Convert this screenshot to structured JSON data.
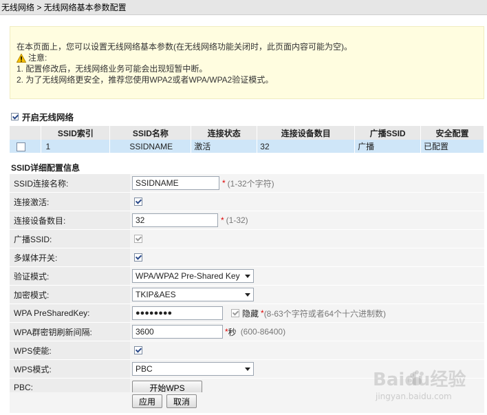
{
  "breadcrumb": "无线网络 > 无线网络基本参数配置",
  "notice": {
    "line1": "在本页面上，您可以设置无线网络基本参数(在无线网络功能关闭时，此页面内容可能为空)。",
    "warning_label": "注意:",
    "line2": "1. 配置修改后，无线网络业务可能会出现短暂中断。",
    "line3": "2. 为了无线网络更安全，推荐您使用WPA2或者WPA/WPA2验证模式。"
  },
  "enable_wifi": {
    "label": "开启无线网络",
    "checked": true
  },
  "ssid_table": {
    "headers": [
      "",
      "SSID索引",
      "SSID名称",
      "连接状态",
      "连接设备数目",
      "广播SSID",
      "安全配置"
    ],
    "rows": [
      {
        "checked": false,
        "index": "1",
        "name": "SSIDNAME",
        "status": "激活",
        "devices": "32",
        "broadcast": "广播",
        "security": "已配置"
      }
    ]
  },
  "detail": {
    "section_title": "SSID详细配置信息",
    "ssid_name_label": "SSID连接名称:",
    "ssid_name_value": "SSIDNAME",
    "ssid_name_hint": "(1-32个字符)",
    "enable_label": "连接激活:",
    "max_devices_label": "连接设备数目:",
    "max_devices_value": "32",
    "max_devices_hint": "(1-32)",
    "broadcast_label": "广播SSID:",
    "wmm_label": "多媒体开关:",
    "auth_label": "验证模式:",
    "auth_value": "WPA/WPA2 Pre-Shared Key",
    "encrypt_label": "加密模式:",
    "encrypt_value": "TKIP&AES",
    "psk_label": "WPA PreSharedKey:",
    "psk_value": "●●●●●●●●",
    "hide_label": "隐藏",
    "psk_hint": "(8-63个字符或者64个十六进制数)",
    "rekey_label": "WPA群密钥刷新间隔:",
    "rekey_value": "3600",
    "rekey_unit": "秒",
    "rekey_hint": "(600-86400)",
    "wps_enable_label": "WPS使能:",
    "wps_mode_label": "WPS模式:",
    "wps_mode_value": "PBC",
    "pbc_label": "PBC:",
    "pbc_button": "开始WPS",
    "required_mark": "*"
  },
  "actions": {
    "apply": "应用",
    "cancel": "取消"
  },
  "watermark": {
    "brand": "Baidu经验",
    "url": "jingyan.baidu.com"
  }
}
